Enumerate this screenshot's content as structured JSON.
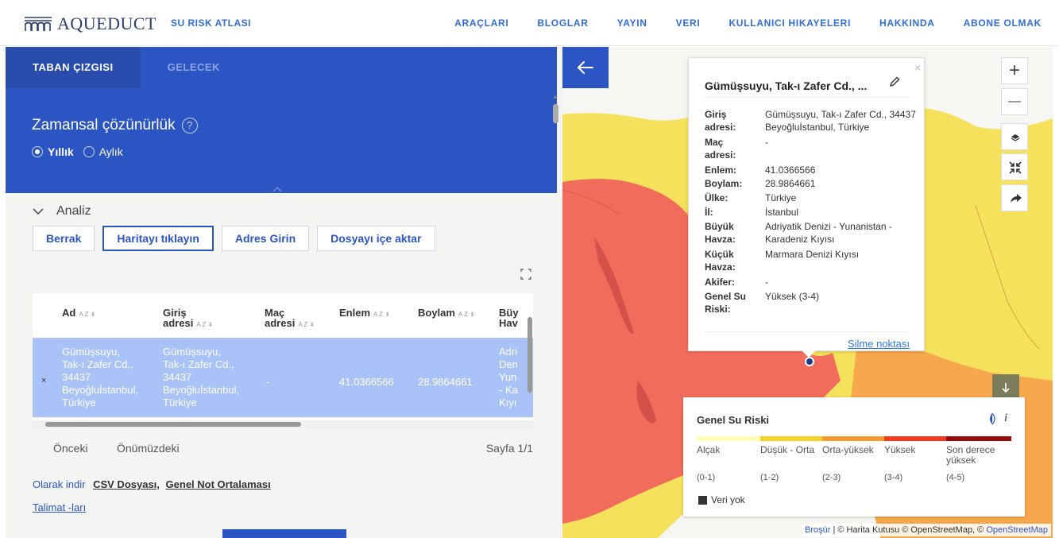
{
  "nav": {
    "brand": "AQUEDUCT",
    "subtitle": "SU RISK ATLASI",
    "links": [
      "ARAÇLARI",
      "BLOGLAR",
      "YAYIN",
      "VERI",
      "KULLANICI HIKAYELERI",
      "HAKKINDA",
      "ABONE OLMAK"
    ]
  },
  "tabs": {
    "baseline": "TABAN ÇIZGISI",
    "future": "GELECEK"
  },
  "temporal": {
    "label": "Zamansal çözünürlük",
    "help": "?",
    "annual": "Yıllık",
    "monthly": "Aylık",
    "selected": "Yıllık"
  },
  "analysis": {
    "title": "Analiz",
    "buttons": [
      "Berrak",
      "Haritayı tıklayın",
      "Adres Girin",
      "Dosyayı içe aktar"
    ],
    "active_button": "Haritayı tıklayın"
  },
  "table": {
    "headers": [
      {
        "l1": "",
        "l2": "Ad"
      },
      {
        "l1": "Giriş",
        "l2": "adresi"
      },
      {
        "l1": "Maç",
        "l2": "adresi"
      },
      {
        "l1": "",
        "l2": "Enlem"
      },
      {
        "l1": "",
        "l2": "Boylam"
      },
      {
        "l1": "Büy",
        "l2": "Hav"
      }
    ],
    "sort_glyph": "A Z ⇟",
    "row": {
      "remove": "×",
      "name": [
        "Gümüşsuyu,",
        "Tak-ı Zafer Cd.,",
        "34437",
        "Beyoğluİstanbul,",
        "Türkiye"
      ],
      "input_address": [
        "Gümüşsuyu,",
        "Tak-ı Zafer Cd.,",
        "34437",
        "Beyoğluİstanbul,",
        "Türkiye"
      ],
      "match_address": "-",
      "lat": "41.0366566",
      "lon": "28.9864661",
      "basin": [
        "Adri",
        "Den",
        "Yun",
        "- Ka",
        "Kıyı"
      ]
    }
  },
  "pager": {
    "prev": "Önceki",
    "next": "Önümüzdeki",
    "page": "Sayfa 1/1"
  },
  "download": {
    "label": "Olarak indir",
    "csv": "CSV Dosyası,",
    "gpa": "Genel Not Ortalaması"
  },
  "instructions": "Talimat -ları",
  "popup": {
    "title": "Gümüşsuyu, Tak-ı Zafer Cd., ...",
    "close": "×",
    "fields": [
      {
        "label": "Giriş adresi:",
        "value": "Gümüşsuyu, Tak-ı Zafer Cd., 34437 Beyoğluİstanbul, Türkiye"
      },
      {
        "label": "Maç adresi:",
        "value": "-"
      },
      {
        "label": "Enlem:",
        "value": "41.0366566"
      },
      {
        "label": "Boylam:",
        "value": "28.9864661"
      },
      {
        "label": "Ülke:",
        "value": "Türkiye"
      },
      {
        "label": "İl:",
        "value": "İstanbul"
      },
      {
        "label": "Büyük Havza:",
        "value": "Adriyatik Denizi - Yunanistan - Karadeniz Kıyısı"
      },
      {
        "label": "Küçük Havza:",
        "value": "Marmara Denizi Kıyısı"
      },
      {
        "label": "Akifer:",
        "value": "-"
      },
      {
        "label": "Genel Su Riski:",
        "value": "Yüksek (3-4)"
      }
    ],
    "delete": "Silme noktası"
  },
  "legend": {
    "title": "Genel Su Riski",
    "info": "i",
    "classes": [
      {
        "label": "Alçak",
        "range": "(0-1)",
        "color": "#fffdb2"
      },
      {
        "label": "Düşük - Orta",
        "range": "(1-2)",
        "color": "#f5d327"
      },
      {
        "label": "Orta-yüksek",
        "range": "(2-3)",
        "color": "#f59b2d"
      },
      {
        "label": "Yüksek",
        "range": "(3-4)",
        "color": "#f23b1c"
      },
      {
        "label": "Son derece yüksek",
        "range": "(4-5)",
        "color": "#9b0a0a"
      }
    ],
    "nodata": "Veri yok"
  },
  "map_controls": {
    "zoom_in": "+",
    "zoom_out": "—"
  },
  "attribution": {
    "brochure": "Broşür",
    "mapbox": "| © Harita Kutusu © OpenStreetMap, ©",
    "osm": "OpenStreetMap"
  },
  "colors": {
    "primary": "#2c55c4",
    "primary_dark": "#2a4cad",
    "link": "#2e6ed6",
    "row_selected": "#a9c2f7",
    "map_red": "#f26c5b",
    "map_yellow": "#f5e15b",
    "map_orange": "#f7a74c"
  }
}
